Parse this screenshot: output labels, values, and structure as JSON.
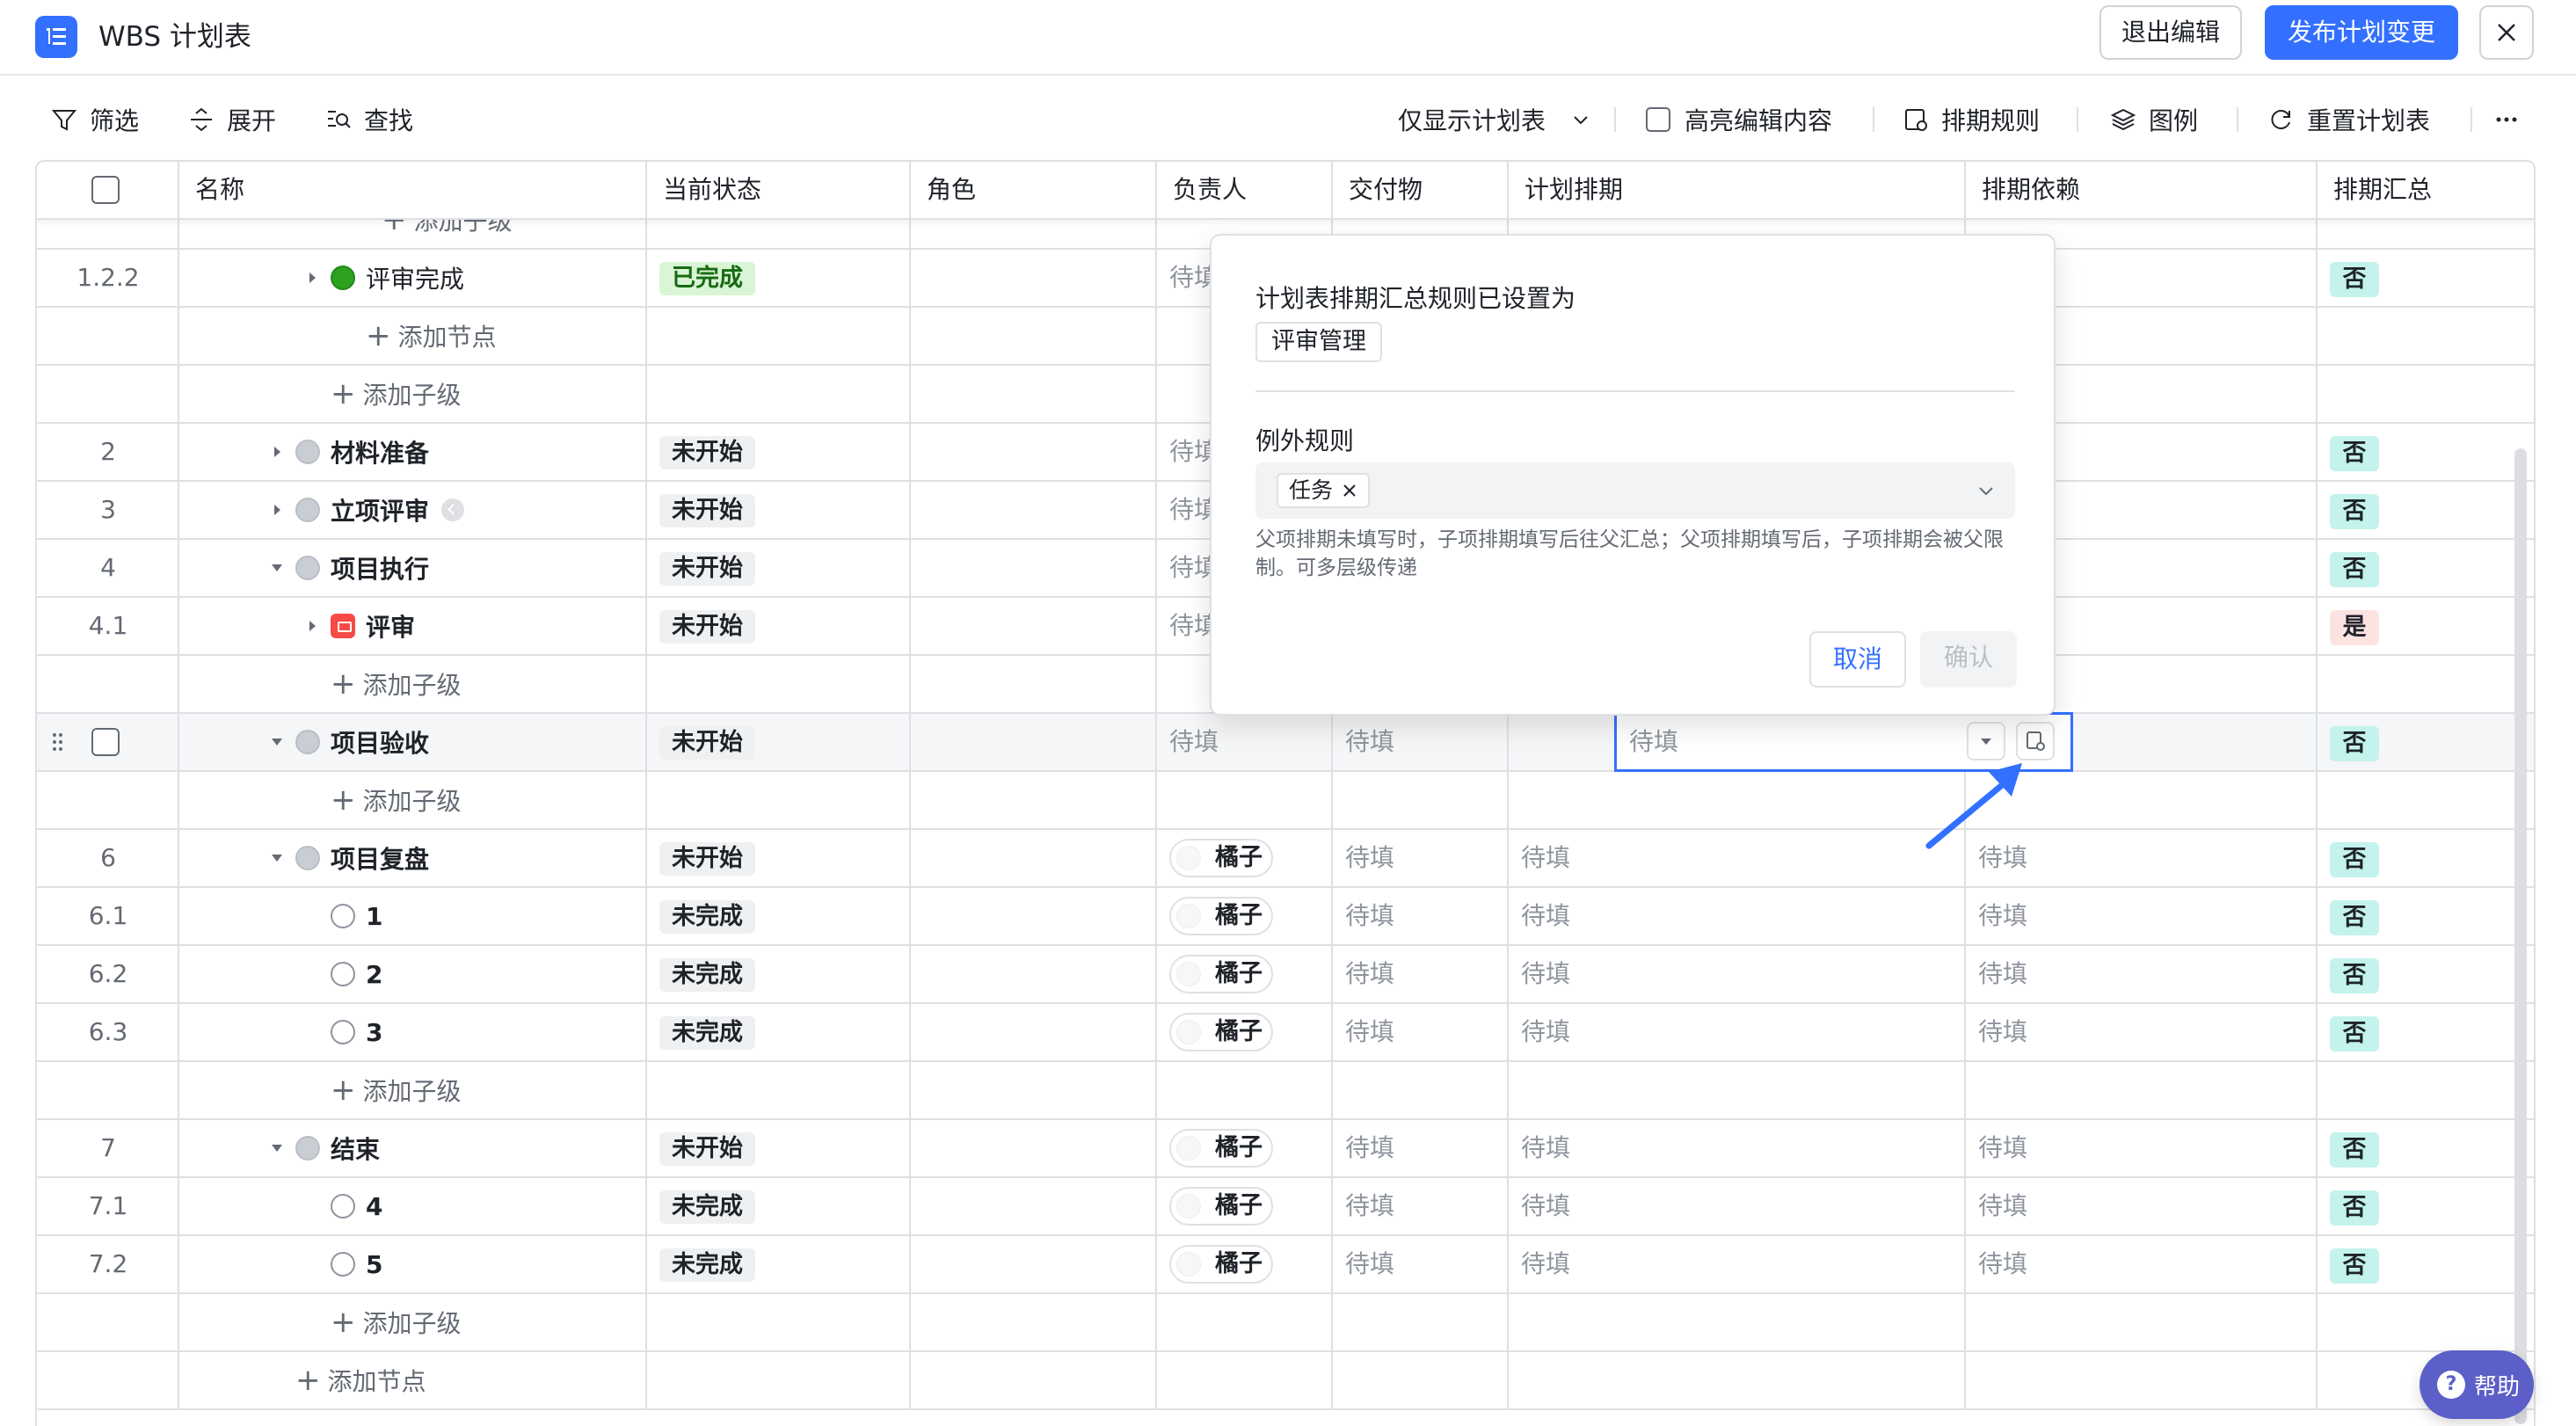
{
  "header": {
    "title": "WBS 计划表",
    "exit_label": "退出编辑",
    "publish_label": "发布计划变更"
  },
  "toolbar": {
    "filter": "筛选",
    "expand": "展开",
    "find": "查找",
    "view_mode": "仅显示计划表",
    "highlight": "高亮编辑内容",
    "schedule_rule": "排期规则",
    "legend": "图例",
    "reset": "重置计划表"
  },
  "columns": {
    "name": "名称",
    "status": "当前状态",
    "role": "角色",
    "owner": "负责人",
    "deliverable": "交付物",
    "schedule": "计划排期",
    "dependency": "排期依赖",
    "rollup": "排期汇总"
  },
  "common": {
    "pending": "待填",
    "add_child": "添加子级",
    "add_node": "添加节点"
  },
  "rows": {
    "r122": {
      "idx": "1.2.2",
      "name": "评审完成",
      "status": "已完成",
      "rollup": "否"
    },
    "r2": {
      "idx": "2",
      "name": "材料准备",
      "status": "未开始",
      "rollup": "否"
    },
    "r3": {
      "idx": "3",
      "name": "立项评审",
      "status": "未开始",
      "rollup": "否"
    },
    "r4": {
      "idx": "4",
      "name": "项目执行",
      "status": "未开始",
      "rollup": "否"
    },
    "r41": {
      "idx": "4.1",
      "name": "评审",
      "status": "未开始",
      "rollup": "是"
    },
    "r5": {
      "name": "项目验收",
      "status": "未开始",
      "rollup": "否"
    },
    "r6": {
      "idx": "6",
      "name": "项目复盘",
      "status": "未开始",
      "owner": "橘子",
      "rollup": "否"
    },
    "r61": {
      "idx": "6.1",
      "name": "1",
      "status": "未完成",
      "owner": "橘子",
      "rollup": "否"
    },
    "r62": {
      "idx": "6.2",
      "name": "2",
      "status": "未完成",
      "owner": "橘子",
      "rollup": "否"
    },
    "r63": {
      "idx": "6.3",
      "name": "3",
      "status": "未完成",
      "owner": "橘子",
      "rollup": "否"
    },
    "r7": {
      "idx": "7",
      "name": "结束",
      "status": "未开始",
      "owner": "橘子",
      "rollup": "否"
    },
    "r71": {
      "idx": "7.1",
      "name": "4",
      "status": "未完成",
      "owner": "橘子",
      "rollup": "否"
    },
    "r72": {
      "idx": "7.2",
      "name": "5",
      "status": "未完成",
      "owner": "橘子",
      "rollup": "否"
    }
  },
  "popover": {
    "title": "计划表排期汇总规则已设置为",
    "rule_tag": "评审管理",
    "exception_label": "例外规则",
    "exception_chip": "任务",
    "hint": "父项排期未填写时，子项排期填写后往父汇总；父项排期填写后，子项排期会被父限制。可多层级传递",
    "cancel": "取消",
    "confirm": "确认"
  },
  "help": {
    "label": "帮助"
  },
  "colors": {
    "accent": "#3370ff",
    "done_bg": "#d9f5d6",
    "no_bg": "#c4f2ec",
    "yes_bg": "#fde2e2",
    "help_bg": "#5b5fc7"
  }
}
